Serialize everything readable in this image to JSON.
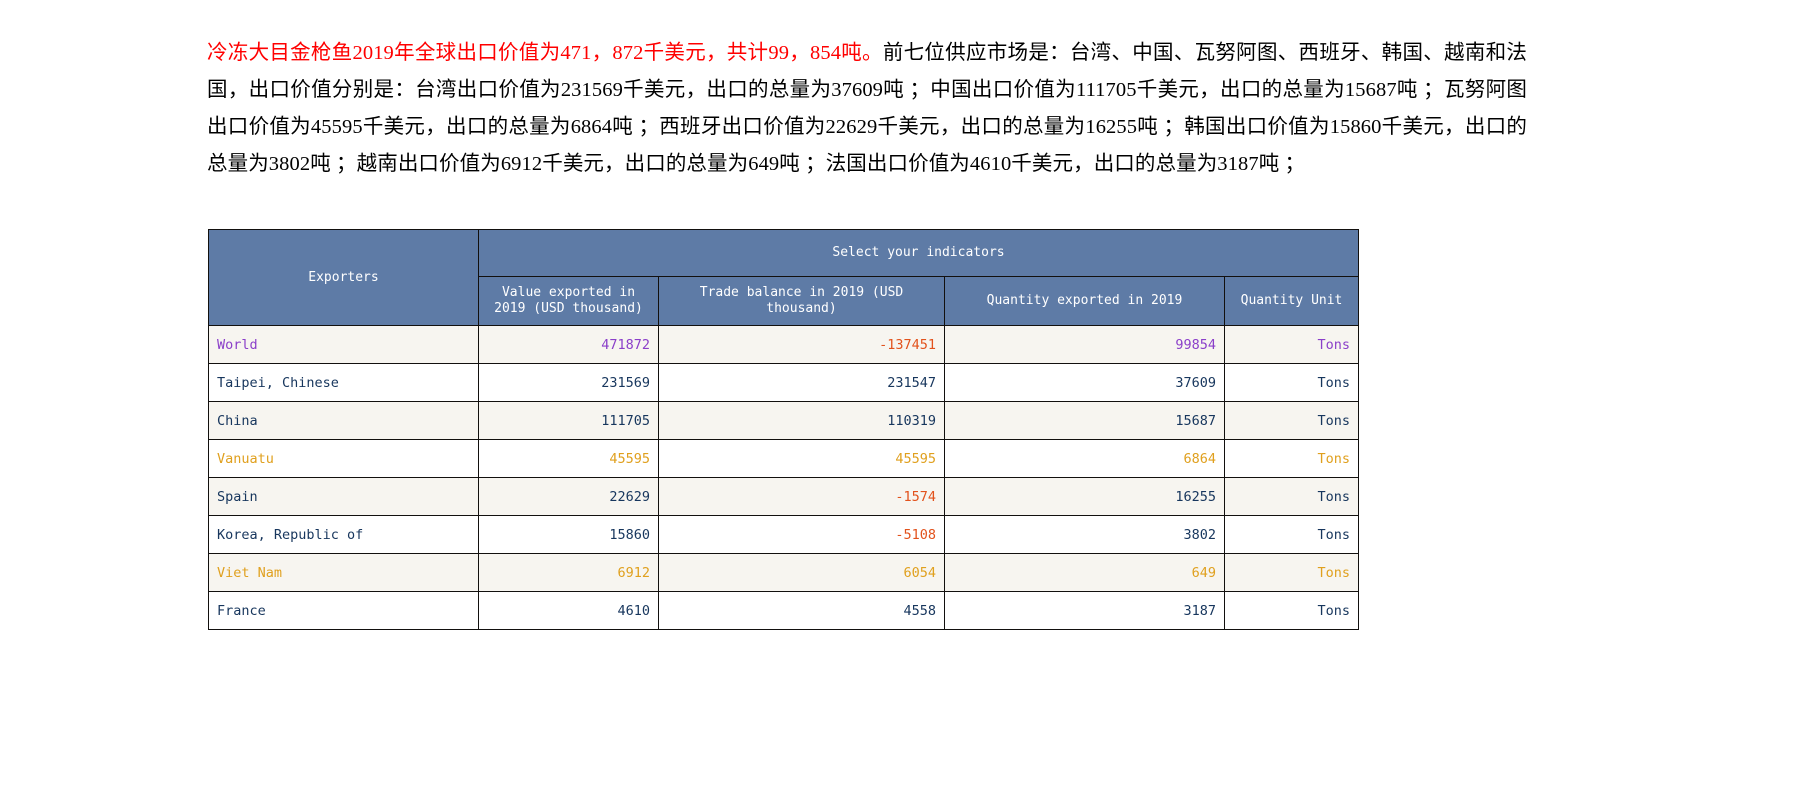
{
  "narrative": {
    "highlight": "冷冻大目金枪鱼2019年全球出口价值为471，872千美元，共计99，854吨。",
    "rest": "前七位供应市场是：台湾、中国、瓦努阿图、西班牙、韩国、越南和法国，出口价值分别是：台湾出口价值为231569千美元，出口的总量为37609吨 ；中国出口价值为111705千美元，出口的总量为15687吨 ；瓦努阿图出口价值为45595千美元，出口的总量为6864吨 ；西班牙出口价值为22629千美元，出口的总量为16255吨 ；韩国出口价值为15860千美元，出口的总量为3802吨 ；越南出口价值为6912千美元，出口的总量为649吨 ；法国出口价值为4610千美元，出口的总量为3187吨 ；"
  },
  "table": {
    "headers": {
      "exporters": "Exporters",
      "group": "Select your indicators",
      "value": "Value exported in 2019 (USD thousand)",
      "balance": "Trade balance in 2019 (USD thousand)",
      "quantity": "Quantity exported in 2019",
      "unit": "Quantity Unit"
    },
    "rows": [
      {
        "exporter": "World",
        "value": "471872",
        "balance": "-137451",
        "quantity": "99854",
        "unit": "Tons",
        "name_color": "t-world",
        "value_color": "t-world",
        "balance_color": "t-neg",
        "quantity_color": "t-world",
        "unit_color": "t-world",
        "band": true
      },
      {
        "exporter": "Taipei, Chinese",
        "value": "231569",
        "balance": "231547",
        "quantity": "37609",
        "unit": "Tons",
        "name_color": "t-default",
        "value_color": "t-default",
        "balance_color": "t-default",
        "quantity_color": "t-default",
        "unit_color": "t-default",
        "band": false
      },
      {
        "exporter": "China",
        "value": "111705",
        "balance": "110319",
        "quantity": "15687",
        "unit": "Tons",
        "name_color": "t-default",
        "value_color": "t-default",
        "balance_color": "t-default",
        "quantity_color": "t-default",
        "unit_color": "t-default",
        "band": true
      },
      {
        "exporter": "Vanuatu",
        "value": "45595",
        "balance": "45595",
        "quantity": "6864",
        "unit": "Tons",
        "name_color": "t-gold",
        "value_color": "t-gold",
        "balance_color": "t-gold",
        "quantity_color": "t-gold",
        "unit_color": "t-gold",
        "band": false
      },
      {
        "exporter": "Spain",
        "value": "22629",
        "balance": "-1574",
        "quantity": "16255",
        "unit": "Tons",
        "name_color": "t-default",
        "value_color": "t-default",
        "balance_color": "t-neg",
        "quantity_color": "t-default",
        "unit_color": "t-default",
        "band": true
      },
      {
        "exporter": "Korea, Republic of",
        "value": "15860",
        "balance": "-5108",
        "quantity": "3802",
        "unit": "Tons",
        "name_color": "t-default",
        "value_color": "t-default",
        "balance_color": "t-neg",
        "quantity_color": "t-default",
        "unit_color": "t-default",
        "band": false
      },
      {
        "exporter": "Viet Nam",
        "value": "6912",
        "balance": "6054",
        "quantity": "649",
        "unit": "Tons",
        "name_color": "t-gold",
        "value_color": "t-gold",
        "balance_color": "t-gold",
        "quantity_color": "t-gold",
        "unit_color": "t-gold",
        "band": true
      },
      {
        "exporter": "France",
        "value": "4610",
        "balance": "4558",
        "quantity": "3187",
        "unit": "Tons",
        "name_color": "t-default",
        "value_color": "t-default",
        "balance_color": "t-default",
        "quantity_color": "t-default",
        "unit_color": "t-default",
        "band": false
      }
    ]
  },
  "colors": {
    "header_bg": "#5e7ba6",
    "band_bg": "#f7f5f0",
    "text_default": "#17365d",
    "text_world": "#8b3fc9",
    "text_gold": "#e0a01e",
    "text_negative": "#e2521c",
    "highlight_text": "#ff0000"
  }
}
